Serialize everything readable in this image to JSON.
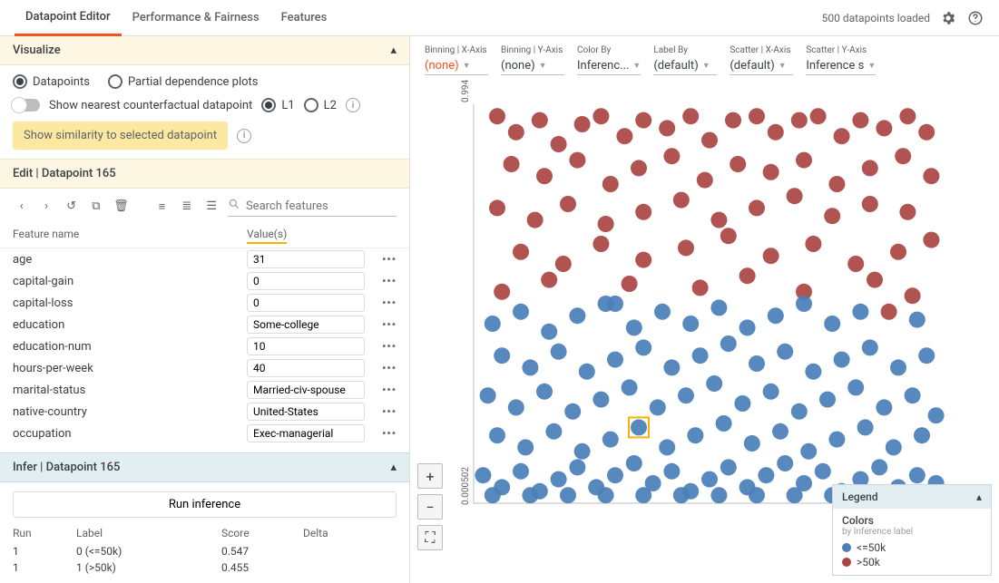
{
  "header": {
    "tabs": [
      "Datapoint Editor",
      "Performance & Fairness",
      "Features"
    ],
    "active_tab": 0,
    "status": "500 datapoints loaded"
  },
  "visualize": {
    "title": "Visualize",
    "mode_options": [
      "Datapoints",
      "Partial dependence plots"
    ],
    "mode_selected": 0,
    "counterfactual_label": "Show nearest counterfactual datapoint",
    "cf_metric_options": [
      "L1",
      "L2"
    ],
    "cf_metric_selected": 0,
    "similarity_button": "Show similarity to selected datapoint"
  },
  "edit": {
    "title": "Edit | Datapoint 165",
    "search_placeholder": "Search features",
    "columns": {
      "name": "Feature name",
      "value": "Value(s)"
    },
    "features": [
      {
        "name": "age",
        "value": "31"
      },
      {
        "name": "capital-gain",
        "value": "0"
      },
      {
        "name": "capital-loss",
        "value": "0"
      },
      {
        "name": "education",
        "value": "Some-college"
      },
      {
        "name": "education-num",
        "value": "10"
      },
      {
        "name": "hours-per-week",
        "value": "40"
      },
      {
        "name": "marital-status",
        "value": "Married-civ-spouse"
      },
      {
        "name": "native-country",
        "value": "United-States"
      },
      {
        "name": "occupation",
        "value": "Exec-managerial"
      }
    ]
  },
  "infer": {
    "title": "Infer | Datapoint 165",
    "run_button": "Run inference",
    "columns": {
      "run": "Run",
      "label": "Label",
      "score": "Score",
      "delta": "Delta"
    },
    "rows": [
      {
        "run": "1",
        "label": "0 (<=50k)",
        "score": "0.547",
        "delta": ""
      },
      {
        "run": "1",
        "label": "1 (>50k)",
        "score": "0.455",
        "delta": ""
      }
    ]
  },
  "controls": [
    {
      "label": "Binning | X-Axis",
      "value": "(none)",
      "accent": true
    },
    {
      "label": "Binning | Y-Axis",
      "value": "(none)",
      "accent": false
    },
    {
      "label": "Color By",
      "value": "Inferenc...",
      "accent": false
    },
    {
      "label": "Label By",
      "value": "(default)",
      "accent": false
    },
    {
      "label": "Scatter | X-Axis",
      "value": "(default)",
      "accent": false
    },
    {
      "label": "Scatter | Y-Axis",
      "value": "Inference s",
      "accent": false
    }
  ],
  "legend": {
    "title": "Legend",
    "section": "Colors",
    "subtitle": "by Inference label",
    "items": [
      {
        "label": "<=50k",
        "color": "#4a7fb8"
      },
      {
        "label": ">50k",
        "color": "#a94442"
      }
    ]
  },
  "chart_data": {
    "type": "scatter",
    "ylabel": "",
    "ylim": [
      0.000502,
      0.994
    ],
    "y_ticks": [
      "0.994",
      "0.000502"
    ],
    "colors": {
      "<=50k": "#4a7fb8",
      ">50k": "#a94442"
    },
    "selected_index": 120,
    "points": [
      {
        "x": 0.05,
        "y": 0.97,
        "c": ">50k"
      },
      {
        "x": 0.09,
        "y": 0.93,
        "c": ">50k"
      },
      {
        "x": 0.14,
        "y": 0.96,
        "c": ">50k"
      },
      {
        "x": 0.18,
        "y": 0.9,
        "c": ">50k"
      },
      {
        "x": 0.23,
        "y": 0.95,
        "c": ">50k"
      },
      {
        "x": 0.27,
        "y": 0.97,
        "c": ">50k"
      },
      {
        "x": 0.32,
        "y": 0.92,
        "c": ">50k"
      },
      {
        "x": 0.36,
        "y": 0.96,
        "c": ">50k"
      },
      {
        "x": 0.41,
        "y": 0.94,
        "c": ">50k"
      },
      {
        "x": 0.46,
        "y": 0.97,
        "c": ">50k"
      },
      {
        "x": 0.5,
        "y": 0.91,
        "c": ">50k"
      },
      {
        "x": 0.55,
        "y": 0.96,
        "c": ">50k"
      },
      {
        "x": 0.6,
        "y": 0.97,
        "c": ">50k"
      },
      {
        "x": 0.64,
        "y": 0.93,
        "c": ">50k"
      },
      {
        "x": 0.69,
        "y": 0.96,
        "c": ">50k"
      },
      {
        "x": 0.73,
        "y": 0.97,
        "c": ">50k"
      },
      {
        "x": 0.78,
        "y": 0.92,
        "c": ">50k"
      },
      {
        "x": 0.82,
        "y": 0.96,
        "c": ">50k"
      },
      {
        "x": 0.87,
        "y": 0.94,
        "c": ">50k"
      },
      {
        "x": 0.92,
        "y": 0.97,
        "c": ">50k"
      },
      {
        "x": 0.96,
        "y": 0.93,
        "c": ">50k"
      },
      {
        "x": 0.08,
        "y": 0.85,
        "c": ">50k"
      },
      {
        "x": 0.15,
        "y": 0.82,
        "c": ">50k"
      },
      {
        "x": 0.22,
        "y": 0.86,
        "c": ">50k"
      },
      {
        "x": 0.29,
        "y": 0.8,
        "c": ">50k"
      },
      {
        "x": 0.35,
        "y": 0.84,
        "c": ">50k"
      },
      {
        "x": 0.42,
        "y": 0.87,
        "c": ">50k"
      },
      {
        "x": 0.49,
        "y": 0.81,
        "c": ">50k"
      },
      {
        "x": 0.56,
        "y": 0.85,
        "c": ">50k"
      },
      {
        "x": 0.63,
        "y": 0.83,
        "c": ">50k"
      },
      {
        "x": 0.7,
        "y": 0.86,
        "c": ">50k"
      },
      {
        "x": 0.77,
        "y": 0.8,
        "c": ">50k"
      },
      {
        "x": 0.84,
        "y": 0.84,
        "c": ">50k"
      },
      {
        "x": 0.91,
        "y": 0.87,
        "c": ">50k"
      },
      {
        "x": 0.97,
        "y": 0.82,
        "c": ">50k"
      },
      {
        "x": 0.05,
        "y": 0.74,
        "c": ">50k"
      },
      {
        "x": 0.13,
        "y": 0.71,
        "c": ">50k"
      },
      {
        "x": 0.2,
        "y": 0.75,
        "c": ">50k"
      },
      {
        "x": 0.28,
        "y": 0.7,
        "c": ">50k"
      },
      {
        "x": 0.36,
        "y": 0.73,
        "c": ">50k"
      },
      {
        "x": 0.44,
        "y": 0.76,
        "c": ">50k"
      },
      {
        "x": 0.52,
        "y": 0.71,
        "c": ">50k"
      },
      {
        "x": 0.6,
        "y": 0.74,
        "c": ">50k"
      },
      {
        "x": 0.68,
        "y": 0.77,
        "c": ">50k"
      },
      {
        "x": 0.76,
        "y": 0.72,
        "c": ">50k"
      },
      {
        "x": 0.84,
        "y": 0.75,
        "c": ">50k"
      },
      {
        "x": 0.92,
        "y": 0.73,
        "c": ">50k"
      },
      {
        "x": 0.1,
        "y": 0.63,
        "c": ">50k"
      },
      {
        "x": 0.19,
        "y": 0.6,
        "c": ">50k"
      },
      {
        "x": 0.27,
        "y": 0.65,
        "c": ">50k"
      },
      {
        "x": 0.36,
        "y": 0.61,
        "c": ">50k"
      },
      {
        "x": 0.45,
        "y": 0.64,
        "c": ">50k"
      },
      {
        "x": 0.54,
        "y": 0.67,
        "c": ">50k"
      },
      {
        "x": 0.63,
        "y": 0.62,
        "c": ">50k"
      },
      {
        "x": 0.72,
        "y": 0.65,
        "c": ">50k"
      },
      {
        "x": 0.81,
        "y": 0.6,
        "c": ">50k"
      },
      {
        "x": 0.9,
        "y": 0.63,
        "c": ">50k"
      },
      {
        "x": 0.97,
        "y": 0.66,
        "c": ">50k"
      },
      {
        "x": 0.06,
        "y": 0.53,
        "c": ">50k"
      },
      {
        "x": 0.16,
        "y": 0.56,
        "c": ">50k"
      },
      {
        "x": 0.33,
        "y": 0.55,
        "c": ">50k"
      },
      {
        "x": 0.48,
        "y": 0.54,
        "c": ">50k"
      },
      {
        "x": 0.58,
        "y": 0.57,
        "c": ">50k"
      },
      {
        "x": 0.7,
        "y": 0.53,
        "c": ">50k"
      },
      {
        "x": 0.85,
        "y": 0.56,
        "c": ">50k"
      },
      {
        "x": 0.93,
        "y": 0.52,
        "c": ">50k"
      },
      {
        "x": 0.88,
        "y": 0.48,
        "c": ">50k"
      },
      {
        "x": 0.04,
        "y": 0.45,
        "c": "<=50k"
      },
      {
        "x": 0.1,
        "y": 0.48,
        "c": "<=50k"
      },
      {
        "x": 0.16,
        "y": 0.43,
        "c": "<=50k"
      },
      {
        "x": 0.22,
        "y": 0.47,
        "c": "<=50k"
      },
      {
        "x": 0.28,
        "y": 0.5,
        "c": "<=50k"
      },
      {
        "x": 0.34,
        "y": 0.44,
        "c": "<=50k"
      },
      {
        "x": 0.4,
        "y": 0.48,
        "c": "<=50k"
      },
      {
        "x": 0.46,
        "y": 0.45,
        "c": "<=50k"
      },
      {
        "x": 0.52,
        "y": 0.49,
        "c": "<=50k"
      },
      {
        "x": 0.58,
        "y": 0.44,
        "c": "<=50k"
      },
      {
        "x": 0.64,
        "y": 0.47,
        "c": "<=50k"
      },
      {
        "x": 0.7,
        "y": 0.5,
        "c": "<=50k"
      },
      {
        "x": 0.76,
        "y": 0.45,
        "c": "<=50k"
      },
      {
        "x": 0.82,
        "y": 0.48,
        "c": "<=50k"
      },
      {
        "x": 0.94,
        "y": 0.46,
        "c": "<=50k"
      },
      {
        "x": 0.06,
        "y": 0.37,
        "c": "<=50k"
      },
      {
        "x": 0.12,
        "y": 0.34,
        "c": "<=50k"
      },
      {
        "x": 0.18,
        "y": 0.38,
        "c": "<=50k"
      },
      {
        "x": 0.24,
        "y": 0.33,
        "c": "<=50k"
      },
      {
        "x": 0.3,
        "y": 0.36,
        "c": "<=50k"
      },
      {
        "x": 0.36,
        "y": 0.39,
        "c": "<=50k"
      },
      {
        "x": 0.42,
        "y": 0.34,
        "c": "<=50k"
      },
      {
        "x": 0.48,
        "y": 0.37,
        "c": "<=50k"
      },
      {
        "x": 0.54,
        "y": 0.4,
        "c": "<=50k"
      },
      {
        "x": 0.6,
        "y": 0.35,
        "c": "<=50k"
      },
      {
        "x": 0.66,
        "y": 0.38,
        "c": "<=50k"
      },
      {
        "x": 0.72,
        "y": 0.33,
        "c": "<=50k"
      },
      {
        "x": 0.78,
        "y": 0.36,
        "c": "<=50k"
      },
      {
        "x": 0.84,
        "y": 0.39,
        "c": "<=50k"
      },
      {
        "x": 0.9,
        "y": 0.34,
        "c": "<=50k"
      },
      {
        "x": 0.96,
        "y": 0.37,
        "c": "<=50k"
      },
      {
        "x": 0.03,
        "y": 0.27,
        "c": "<=50k"
      },
      {
        "x": 0.09,
        "y": 0.24,
        "c": "<=50k"
      },
      {
        "x": 0.15,
        "y": 0.28,
        "c": "<=50k"
      },
      {
        "x": 0.21,
        "y": 0.23,
        "c": "<=50k"
      },
      {
        "x": 0.27,
        "y": 0.26,
        "c": "<=50k"
      },
      {
        "x": 0.33,
        "y": 0.29,
        "c": "<=50k"
      },
      {
        "x": 0.39,
        "y": 0.24,
        "c": "<=50k"
      },
      {
        "x": 0.45,
        "y": 0.27,
        "c": "<=50k"
      },
      {
        "x": 0.51,
        "y": 0.3,
        "c": "<=50k"
      },
      {
        "x": 0.57,
        "y": 0.25,
        "c": "<=50k"
      },
      {
        "x": 0.63,
        "y": 0.28,
        "c": "<=50k"
      },
      {
        "x": 0.69,
        "y": 0.23,
        "c": "<=50k"
      },
      {
        "x": 0.75,
        "y": 0.26,
        "c": "<=50k"
      },
      {
        "x": 0.81,
        "y": 0.29,
        "c": "<=50k"
      },
      {
        "x": 0.87,
        "y": 0.24,
        "c": "<=50k"
      },
      {
        "x": 0.93,
        "y": 0.27,
        "c": "<=50k"
      },
      {
        "x": 0.98,
        "y": 0.22,
        "c": "<=50k"
      },
      {
        "x": 0.05,
        "y": 0.17,
        "c": "<=50k"
      },
      {
        "x": 0.11,
        "y": 0.14,
        "c": "<=50k"
      },
      {
        "x": 0.17,
        "y": 0.18,
        "c": "<=50k"
      },
      {
        "x": 0.23,
        "y": 0.13,
        "c": "<=50k"
      },
      {
        "x": 0.29,
        "y": 0.16,
        "c": "<=50k"
      },
      {
        "x": 0.35,
        "y": 0.19,
        "c": "<=50k"
      },
      {
        "x": 0.41,
        "y": 0.14,
        "c": "<=50k"
      },
      {
        "x": 0.47,
        "y": 0.17,
        "c": "<=50k"
      },
      {
        "x": 0.53,
        "y": 0.2,
        "c": "<=50k"
      },
      {
        "x": 0.59,
        "y": 0.15,
        "c": "<=50k"
      },
      {
        "x": 0.65,
        "y": 0.18,
        "c": "<=50k"
      },
      {
        "x": 0.71,
        "y": 0.13,
        "c": "<=50k"
      },
      {
        "x": 0.77,
        "y": 0.16,
        "c": "<=50k"
      },
      {
        "x": 0.83,
        "y": 0.19,
        "c": "<=50k"
      },
      {
        "x": 0.89,
        "y": 0.14,
        "c": "<=50k"
      },
      {
        "x": 0.95,
        "y": 0.17,
        "c": "<=50k"
      },
      {
        "x": 0.3,
        "y": 0.5,
        "c": "<=50k"
      },
      {
        "x": 0.02,
        "y": 0.07,
        "c": "<=50k"
      },
      {
        "x": 0.06,
        "y": 0.04,
        "c": "<=50k"
      },
      {
        "x": 0.1,
        "y": 0.08,
        "c": "<=50k"
      },
      {
        "x": 0.14,
        "y": 0.03,
        "c": "<=50k"
      },
      {
        "x": 0.18,
        "y": 0.06,
        "c": "<=50k"
      },
      {
        "x": 0.22,
        "y": 0.09,
        "c": "<=50k"
      },
      {
        "x": 0.26,
        "y": 0.04,
        "c": "<=50k"
      },
      {
        "x": 0.3,
        "y": 0.07,
        "c": "<=50k"
      },
      {
        "x": 0.34,
        "y": 0.1,
        "c": "<=50k"
      },
      {
        "x": 0.38,
        "y": 0.05,
        "c": "<=50k"
      },
      {
        "x": 0.42,
        "y": 0.08,
        "c": "<=50k"
      },
      {
        "x": 0.46,
        "y": 0.03,
        "c": "<=50k"
      },
      {
        "x": 0.5,
        "y": 0.06,
        "c": "<=50k"
      },
      {
        "x": 0.54,
        "y": 0.09,
        "c": "<=50k"
      },
      {
        "x": 0.58,
        "y": 0.04,
        "c": "<=50k"
      },
      {
        "x": 0.62,
        "y": 0.07,
        "c": "<=50k"
      },
      {
        "x": 0.66,
        "y": 0.1,
        "c": "<=50k"
      },
      {
        "x": 0.7,
        "y": 0.05,
        "c": "<=50k"
      },
      {
        "x": 0.74,
        "y": 0.08,
        "c": "<=50k"
      },
      {
        "x": 0.78,
        "y": 0.03,
        "c": "<=50k"
      },
      {
        "x": 0.82,
        "y": 0.06,
        "c": "<=50k"
      },
      {
        "x": 0.86,
        "y": 0.09,
        "c": "<=50k"
      },
      {
        "x": 0.9,
        "y": 0.04,
        "c": "<=50k"
      },
      {
        "x": 0.94,
        "y": 0.07,
        "c": "<=50k"
      },
      {
        "x": 0.98,
        "y": 0.05,
        "c": "<=50k"
      },
      {
        "x": 0.04,
        "y": 0.02,
        "c": "<=50k"
      },
      {
        "x": 0.12,
        "y": 0.02,
        "c": "<=50k"
      },
      {
        "x": 0.2,
        "y": 0.02,
        "c": "<=50k"
      },
      {
        "x": 0.28,
        "y": 0.02,
        "c": "<=50k"
      },
      {
        "x": 0.36,
        "y": 0.02,
        "c": "<=50k"
      },
      {
        "x": 0.44,
        "y": 0.02,
        "c": "<=50k"
      },
      {
        "x": 0.52,
        "y": 0.02,
        "c": "<=50k"
      },
      {
        "x": 0.6,
        "y": 0.02,
        "c": "<=50k"
      },
      {
        "x": 0.68,
        "y": 0.02,
        "c": "<=50k"
      },
      {
        "x": 0.76,
        "y": 0.02,
        "c": "<=50k"
      },
      {
        "x": 0.84,
        "y": 0.02,
        "c": "<=50k"
      },
      {
        "x": 0.92,
        "y": 0.02,
        "c": "<=50k"
      }
    ]
  }
}
